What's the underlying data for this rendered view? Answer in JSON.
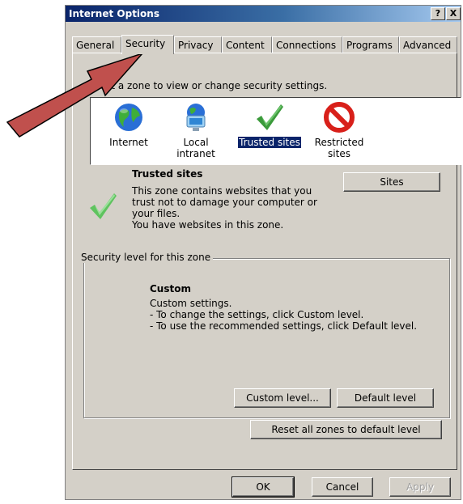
{
  "window": {
    "title": "Internet Options",
    "help_button": "?",
    "close_button": "X"
  },
  "tabs": [
    {
      "label": "General"
    },
    {
      "label": "Security"
    },
    {
      "label": "Privacy"
    },
    {
      "label": "Content"
    },
    {
      "label": "Connections"
    },
    {
      "label": "Programs"
    },
    {
      "label": "Advanced"
    }
  ],
  "zone_instruction": "Select a zone to view or change security settings.",
  "zones": [
    {
      "label": "Internet",
      "icon": "globe-icon"
    },
    {
      "label": "Local intranet",
      "icon": "computer-globe-icon"
    },
    {
      "label": "Trusted sites",
      "icon": "green-checkmark-icon",
      "selected": true
    },
    {
      "label_line1": "Restricted",
      "label_line2": "sites",
      "icon": "no-entry-icon"
    }
  ],
  "zone_details": {
    "title": "Trusted sites",
    "desc_line1": "This zone contains websites that you",
    "desc_line2": "trust not to damage your computer or",
    "desc_line3": "your files.",
    "status": "You have websites in this zone.",
    "sites_button": "Sites"
  },
  "security_level": {
    "legend": "Security level for this zone",
    "level_title": "Custom",
    "line1": "Custom settings.",
    "line2": "- To change the settings, click Custom level.",
    "line3": "- To use the recommended settings, click Default level.",
    "custom_level_button": "Custom level...",
    "default_level_button": "Default level"
  },
  "reset_button": "Reset all zones to default level",
  "footer": {
    "ok": "OK",
    "cancel": "Cancel",
    "apply": "Apply"
  },
  "colors": {
    "titlebar": "#0a246a",
    "selection": "#0a246a",
    "arrow_fill": "#c0504d",
    "checkmark": "#3a9a3a",
    "restricted": "#d8201a"
  }
}
